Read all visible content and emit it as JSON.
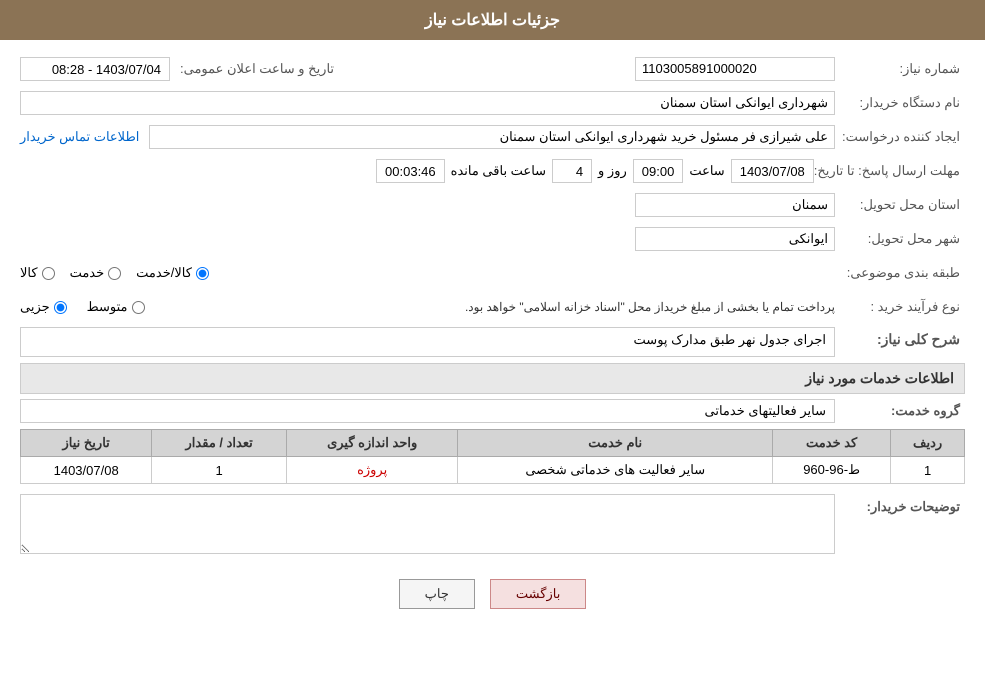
{
  "header": {
    "title": "جزئیات اطلاعات نیاز"
  },
  "fields": {
    "shomara_label": "شماره نیاز:",
    "shomara_value": "1103005891000020",
    "namdastgah_label": "نام دستگاه خریدار:",
    "namdastgah_value": "شهرداری ایوانکی استان سمنان",
    "creator_label": "ایجاد کننده درخواست:",
    "creator_value": "علی شیرازی فر مسئول خرید شهرداری ایوانکی استان سمنان",
    "contact_link": "اطلاعات تماس خریدار",
    "date_label": "مهلت ارسال پاسخ: تا تاریخ:",
    "date_date": "1403/07/08",
    "date_time_label": "ساعت",
    "date_time": "09:00",
    "date_day_label": "روز و",
    "date_days": "4",
    "date_remaining_label": "ساعت باقی مانده",
    "date_remaining": "00:03:46",
    "announce_label": "تاریخ و ساعت اعلان عمومی:",
    "announce_value": "1403/07/04 - 08:28",
    "province_label": "استان محل تحویل:",
    "province_value": "سمنان",
    "city_label": "شهر محل تحویل:",
    "city_value": "ایوانکی",
    "category_label": "طبقه بندی موضوعی:",
    "category_options": [
      {
        "label": "کالا",
        "value": "kala",
        "checked": false
      },
      {
        "label": "خدمت",
        "value": "khadmat",
        "checked": false
      },
      {
        "label": "کالا/خدمت",
        "value": "kala_khadmat",
        "checked": true
      }
    ],
    "purchase_type_label": "نوع فرآیند خرید :",
    "purchase_options": [
      {
        "label": "جزیی",
        "value": "jozee",
        "checked": true
      },
      {
        "label": "متوسط",
        "value": "motavaset",
        "checked": false
      }
    ],
    "purchase_note": "پرداخت تمام یا بخشی از مبلغ خریداز محل \"اسناد خزانه اسلامی\" خواهد بود."
  },
  "sharh": {
    "label": "شرح کلی نیاز:",
    "value": "اجرای جدول نهر طبق مدارک پوست"
  },
  "services_section": {
    "title": "اطلاعات خدمات مورد نیاز",
    "group_label": "گروه خدمت:",
    "group_value": "سایر فعالیتهای خدماتی",
    "table": {
      "headers": [
        "ردیف",
        "کد خدمت",
        "نام خدمت",
        "واحد اندازه گیری",
        "تعداد / مقدار",
        "تاریخ نیاز"
      ],
      "rows": [
        {
          "row": "1",
          "code": "ط-96-960",
          "name": "سایر فعالیت های خدماتی شخصی",
          "unit": "پروژه",
          "qty": "1",
          "date": "1403/07/08"
        }
      ]
    }
  },
  "notes": {
    "label": "توضیحات خریدار:",
    "value": ""
  },
  "buttons": {
    "print": "چاپ",
    "back": "بازگشت"
  }
}
